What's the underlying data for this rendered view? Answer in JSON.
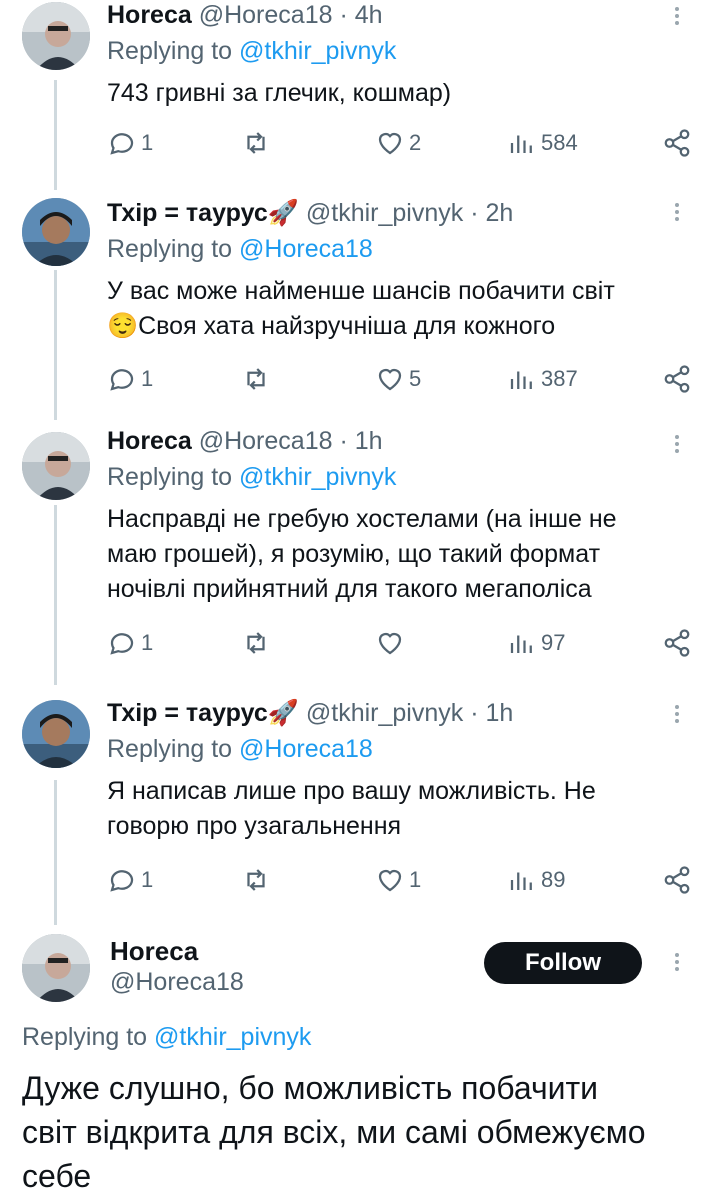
{
  "tweets": [
    {
      "name": "Horeca",
      "handle": "@Horeca18",
      "time": "4h",
      "replying_label": "Replying to",
      "replying_to": "@tkhir_pivnyk",
      "text": [
        "743 гривні за глечик, кошмар)"
      ],
      "replies": "1",
      "retweets": "",
      "likes": "2",
      "views": "584",
      "avatar": "avatar-horeca"
    },
    {
      "name": "Тхір = таурус🚀",
      "handle": "@tkhir_pivnyk",
      "time": "2h",
      "replying_label": "Replying to",
      "replying_to": "@Horeca18",
      "text": [
        "У вас може найменше шансів побачити світ",
        "😌Своя хата найзручніша для кожного"
      ],
      "replies": "1",
      "retweets": "",
      "likes": "5",
      "views": "387",
      "avatar": "avatar-tkhir"
    },
    {
      "name": "Horeca",
      "handle": "@Horeca18",
      "time": "1h",
      "replying_label": "Replying to",
      "replying_to": "@tkhir_pivnyk",
      "text": [
        "Насправді не гребую хостелами (на інше не",
        "маю грошей), я розумію, що такий формат",
        "ночівлі прийнятний для такого мегаполіса"
      ],
      "replies": "1",
      "retweets": "",
      "likes": "",
      "views": "97",
      "avatar": "avatar-horeca"
    },
    {
      "name": "Тхір = таурус🚀",
      "handle": "@tkhir_pivnyk",
      "time": "1h",
      "replying_label": "Replying to",
      "replying_to": "@Horeca18",
      "text": [
        "Я написав лише про вашу можливість. Не",
        "говорю про узагальнення"
      ],
      "replies": "1",
      "retweets": "",
      "likes": "1",
      "views": "89",
      "avatar": "avatar-tkhir"
    }
  ],
  "main": {
    "name": "Horeca",
    "handle": "@Horeca18",
    "follow_label": "Follow",
    "replying_label": "Replying to",
    "replying_to": "@tkhir_pivnyk",
    "text": [
      "Дуже слушно, бо можливість побачити",
      "світ відкрита для всіх, ми самі обмежуємо",
      "себе"
    ]
  },
  "colors": {
    "text": "#0f1419",
    "secondary": "#536471",
    "link": "#1d9bf0",
    "line": "#cfd9de",
    "follow_bg": "#0f1419"
  },
  "icons": [
    "reply-icon",
    "retweet-icon",
    "like-icon",
    "views-icon",
    "share-icon",
    "more-icon"
  ]
}
